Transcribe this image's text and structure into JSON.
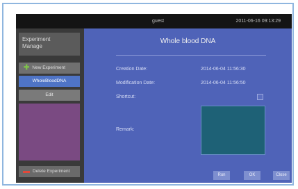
{
  "topbar": {
    "user": "guest",
    "datetime": "2011-06-16 09:13:29"
  },
  "sidebar": {
    "title_line1": "Experiment",
    "title_line2": "Manage",
    "new_experiment": "New Experiment",
    "selected_item": "WholeBloodDNA",
    "edit": "Edit",
    "delete_experiment": "Delete Experiment"
  },
  "main": {
    "title": "Whole blood DNA",
    "creation_date_label": "Creation Date:",
    "creation_date_value": "2014-06-04 11:56:30",
    "modification_date_label": "Modification Date:",
    "modification_date_value": "2014-06-04 11:56:50",
    "shortcut_label": "Shortcut:",
    "remark_label": "Remark:"
  },
  "footer_buttons": {
    "run": "Run",
    "ok": "OK",
    "cancel": "Close"
  },
  "colors": {
    "main_bg": "#4f63b8",
    "sidebar_bg": "#3a3a3a",
    "selected": "#4f74c6",
    "remark_box": "#1e6176"
  }
}
